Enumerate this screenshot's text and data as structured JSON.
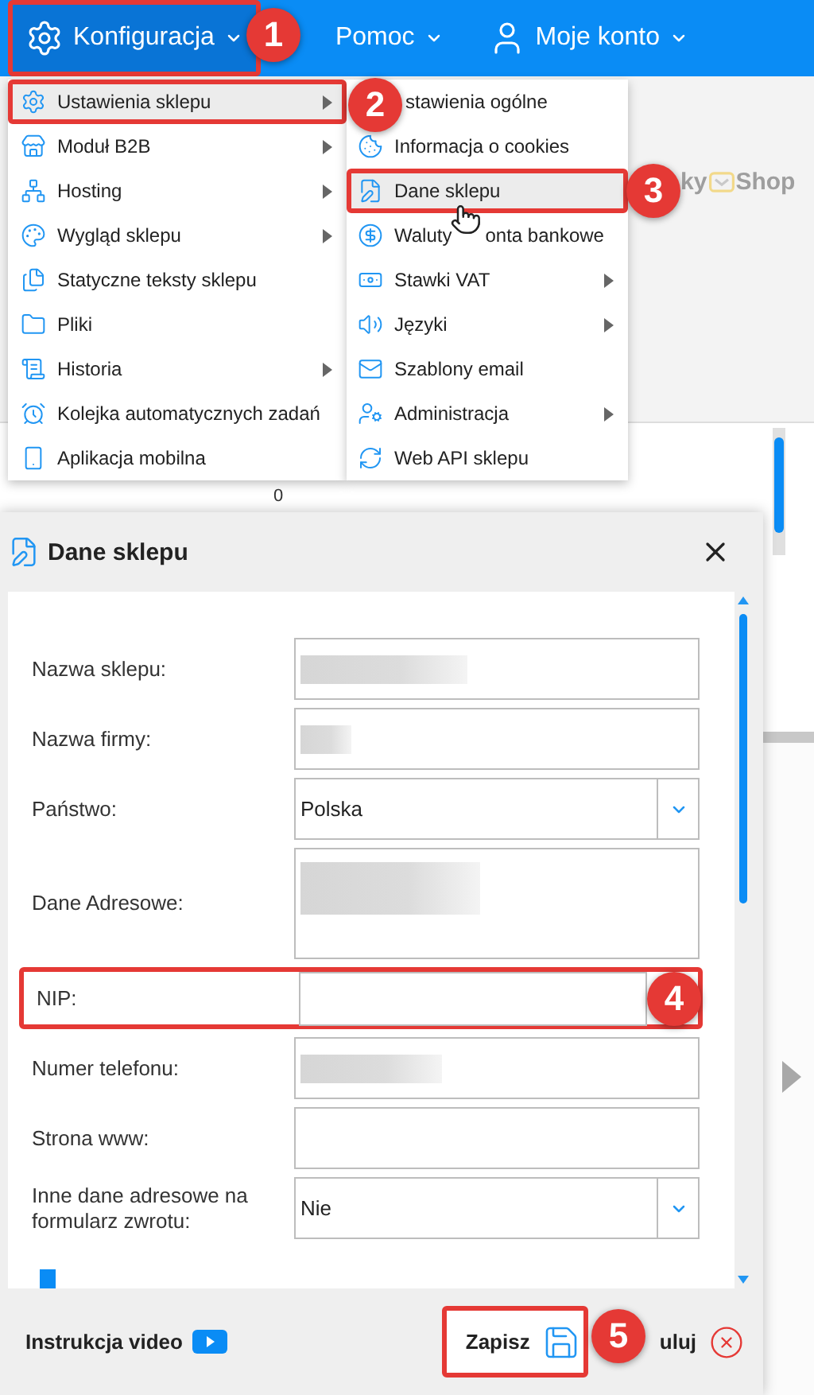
{
  "nav": {
    "items": [
      {
        "label": "Konfiguracja",
        "kind": "settings",
        "selected": true
      },
      {
        "label": "Pomoc",
        "kind": "plain",
        "selected": false
      },
      {
        "label": "Moje konto",
        "kind": "account",
        "selected": false
      }
    ]
  },
  "menu": {
    "items": [
      {
        "label": "Ustawienia sklepu",
        "has_submenu": true,
        "selected": true
      },
      {
        "label": "Moduł B2B",
        "has_submenu": true,
        "selected": false
      },
      {
        "label": "Hosting",
        "has_submenu": true,
        "selected": false
      },
      {
        "label": "Wygląd sklepu",
        "has_submenu": true,
        "selected": false
      },
      {
        "label": "Statyczne teksty sklepu",
        "has_submenu": false,
        "selected": false
      },
      {
        "label": "Pliki",
        "has_submenu": false,
        "selected": false
      },
      {
        "label": "Historia",
        "has_submenu": true,
        "selected": false
      },
      {
        "label": "Kolejka automatycznych zadań",
        "has_submenu": false,
        "selected": false
      },
      {
        "label": "Aplikacja mobilna",
        "has_submenu": false,
        "selected": false
      }
    ]
  },
  "submenu": {
    "items": [
      {
        "label": "stawienia ogólne",
        "has_submenu": false,
        "selected": false
      },
      {
        "label": "Informacja o cookies",
        "has_submenu": false,
        "selected": false
      },
      {
        "label": "Dane sklepu",
        "has_submenu": false,
        "selected": true
      },
      {
        "label": "Waluty",
        "label_rest": "onta bankowe",
        "has_submenu": false,
        "selected": false
      },
      {
        "label": "Stawki VAT",
        "has_submenu": true,
        "selected": false
      },
      {
        "label": "Języki",
        "has_submenu": true,
        "selected": false
      },
      {
        "label": "Szablony email",
        "has_submenu": false,
        "selected": false
      },
      {
        "label": "Administracja",
        "has_submenu": true,
        "selected": false
      },
      {
        "label": "Web API sklepu",
        "has_submenu": false,
        "selected": false
      }
    ]
  },
  "background": {
    "logo": {
      "part_1": "ky",
      "part_2": "Shop"
    },
    "cell": "0"
  },
  "dialog": {
    "title": "Dane sklepu",
    "fields": [
      {
        "label": "Nazwa sklepu:",
        "kind": "text",
        "redacted": true,
        "highlighted": false
      },
      {
        "label": "Nazwa firmy:",
        "kind": "text",
        "redacted": true,
        "highlighted": false
      },
      {
        "label": "Państwo:",
        "kind": "select",
        "value": "Polska",
        "highlighted": false
      },
      {
        "label": "Dane Adresowe:",
        "kind": "textarea",
        "redacted": true,
        "highlighted": false
      },
      {
        "label": "NIP:",
        "kind": "text",
        "redacted": false,
        "highlighted": true
      },
      {
        "label": "Numer telefonu:",
        "kind": "text",
        "redacted": true,
        "highlighted": false
      },
      {
        "label": "Strona www:",
        "kind": "text",
        "redacted": false,
        "highlighted": false
      },
      {
        "label": "Inne dane adresowe na formularz zwrotu:",
        "kind": "select",
        "value": "Nie",
        "highlighted": false
      }
    ],
    "video_link": "Instrukcja video",
    "save_button": {
      "label": "Zapisz",
      "highlighted": true
    },
    "cancel_button": {
      "label": "uluj"
    }
  },
  "callouts": [
    "1",
    "2",
    "3",
    "4",
    "5"
  ]
}
